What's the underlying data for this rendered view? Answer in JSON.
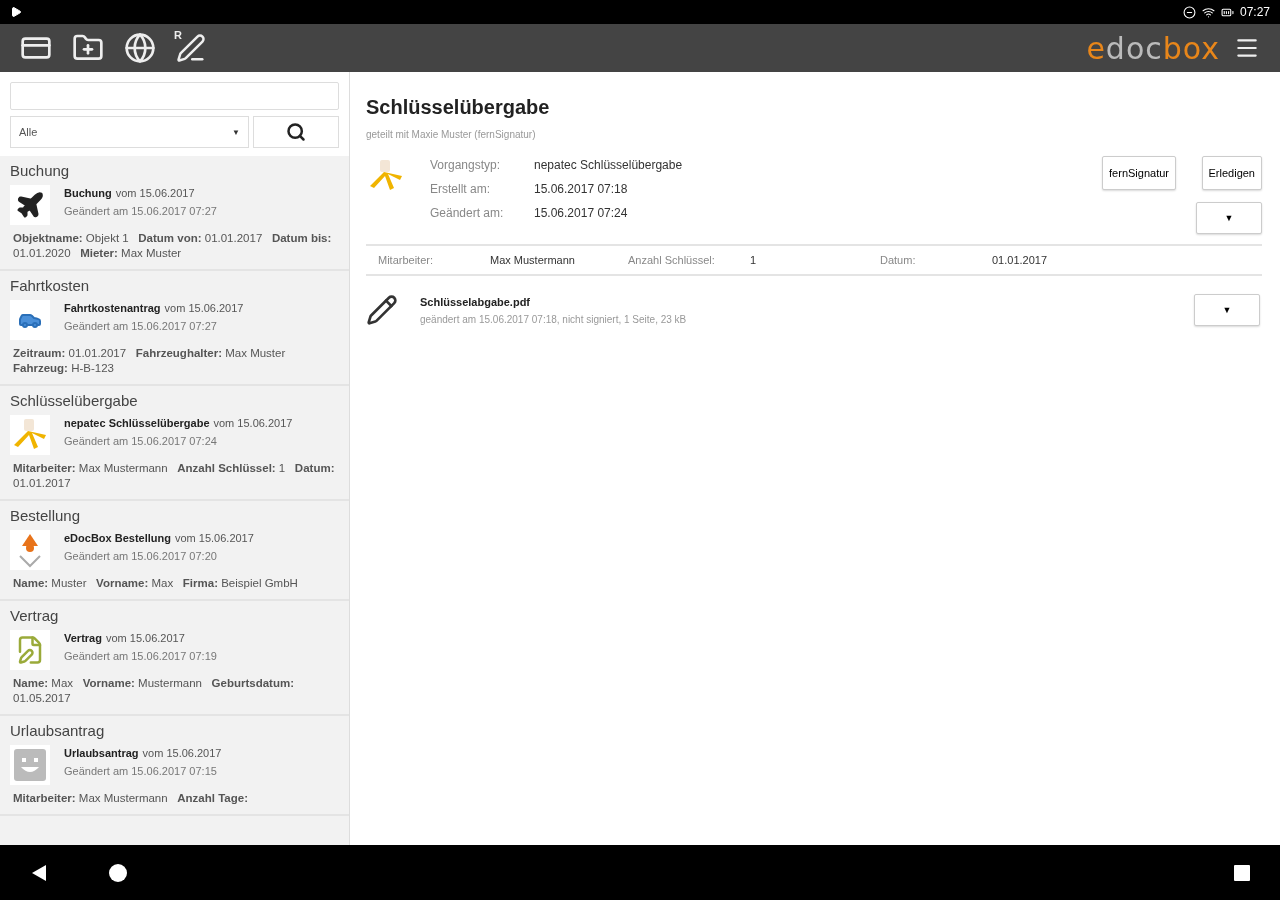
{
  "status_bar": {
    "time": "07:27"
  },
  "toolbar": {
    "logo": [
      {
        "text": "e",
        "accent": true
      },
      {
        "text": "doc",
        "accent": false
      },
      {
        "text": "box",
        "accent": true
      }
    ],
    "signature_letter": "R"
  },
  "sidebar": {
    "filter": {
      "value": "Alle",
      "caret": "▼"
    },
    "groups": [
      {
        "title": "Buchung",
        "kind": "plane",
        "name": "Buchung",
        "date": "vom 15.06.2017",
        "changed": "Geändert am 15.06.2017 07:27",
        "fields": [
          "**Objektname:** Objekt 1",
          "**Datum von:** 01.01.2017",
          "**Datum bis:** 01.01.2020",
          "**Mieter:** Max Muster"
        ]
      },
      {
        "title": "Fahrtkosten",
        "kind": "car",
        "name": "Fahrtkostenantrag",
        "date": "vom 15.06.2017",
        "changed": "Geändert am 15.06.2017 07:27",
        "fields": [
          "**Zeitraum:** 01.01.2017",
          "**Fahrzeughalter:** Max Muster",
          "**Fahrzeug:** H-B-123"
        ]
      },
      {
        "title": "Schlüsselübergabe",
        "kind": "keys",
        "name": "nepatec Schlüsselübergabe",
        "date": "vom 15.06.2017",
        "changed": "Geändert am 15.06.2017 07:24",
        "fields": [
          "**Mitarbeiter:** Max Mustermann",
          "**Anzahl Schlüssel:** 1",
          "**Datum:** 01.01.2017"
        ]
      },
      {
        "title": "Bestellung",
        "kind": "order",
        "name": "eDocBox Bestellung",
        "date": "vom 15.06.2017",
        "changed": "Geändert am 15.06.2017 07:20",
        "fields": [
          "**Name:** Muster",
          "**Vorname:** Max",
          "**Firma:** Beispiel GmbH"
        ]
      },
      {
        "title": "Vertrag",
        "kind": "contract",
        "name": "Vertrag",
        "date": "vom 15.06.2017",
        "changed": "Geändert am 15.06.2017 07:19",
        "fields": [
          "**Name:** Max",
          "**Vorname:** Mustermann",
          "**Geburtsdatum:** 01.05.2017"
        ]
      },
      {
        "title": "Urlaubsantrag",
        "kind": "smiley",
        "name": "Urlaubsantrag",
        "date": "vom 15.06.2017",
        "changed": "Geändert am 15.06.2017 07:15",
        "fields": [
          "**Mitarbeiter:** Max Mustermann",
          "**Anzahl Tage:**"
        ]
      }
    ]
  },
  "detail": {
    "title": "Schlüsselübergabe",
    "shared": "geteilt mit Maxie Muster (fernSignatur)",
    "meta": [
      {
        "label": "Vorgangstyp:",
        "value": "nepatec Schlüsselübergabe"
      },
      {
        "label": "Erstellt am:",
        "value": "15.06.2017 07:18"
      },
      {
        "label": "Geändert am:",
        "value": "15.06.2017 07:24"
      }
    ],
    "buttons": [
      "fernSignatur",
      "Erledigen"
    ],
    "menu_caret": "▼",
    "fields": [
      {
        "label": "Mitarbeiter:",
        "value": "Max Mustermann"
      },
      {
        "label": "Anzahl Schlüssel:",
        "value": "1"
      },
      {
        "label": "Datum:",
        "value": "01.01.2017"
      }
    ],
    "document": {
      "name": "Schlüsselabgabe.pdf",
      "info": "geändert am 15.06.2017 07:18, nicht signiert, 1 Seite, 23 kB",
      "menu_caret": "▼"
    }
  }
}
